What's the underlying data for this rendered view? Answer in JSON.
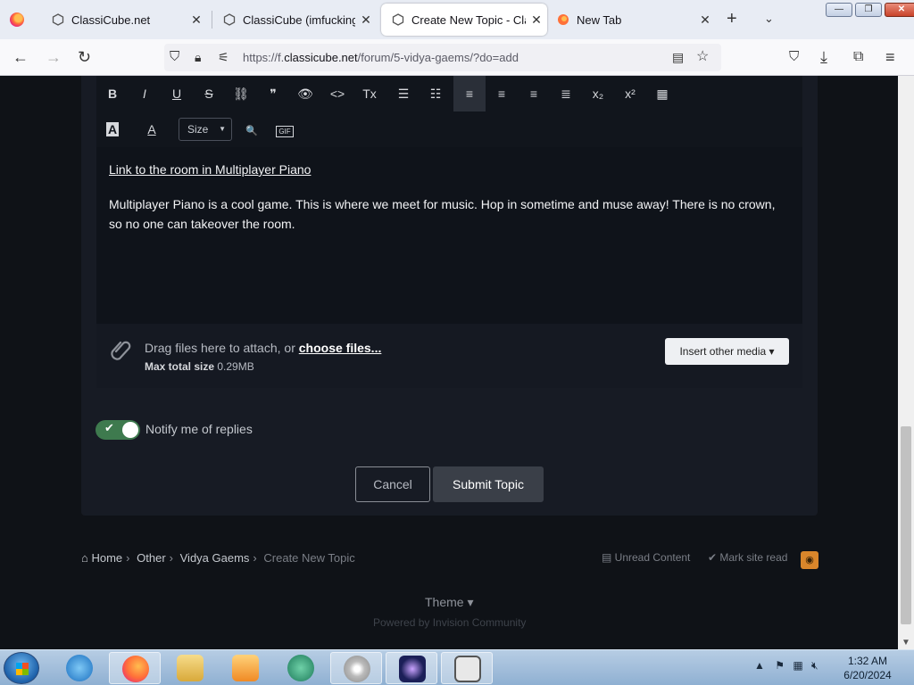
{
  "browser": {
    "tabs": [
      {
        "title": "ClassiCube.net",
        "close": "✕",
        "icon": "classicube-icon"
      },
      {
        "title": "ClassiCube (imfuckingo",
        "close": "✕",
        "icon": "classicube-icon"
      },
      {
        "title": "Create New Topic - Class",
        "close": "✕",
        "icon": "classicube-icon",
        "active": true
      },
      {
        "title": "New Tab",
        "close": "✕",
        "icon": "firefox-icon"
      }
    ],
    "new_tab": "+",
    "list_tabs": "⌄",
    "window_buttons": {
      "minimize": "—",
      "maximize": "❐",
      "close": "✕"
    },
    "url_prefix": "https://f.",
    "url_domain": "classicube.net",
    "url_path": "/forum/5-vidya-gaems/?do=add"
  },
  "editor": {
    "toolbar_row1": [
      {
        "name": "bold-button",
        "glyph": "B"
      },
      {
        "name": "italic-button",
        "glyph": "I"
      },
      {
        "name": "underline-button",
        "glyph": "U"
      },
      {
        "name": "strikethrough-button",
        "glyph": "S"
      },
      {
        "name": "link-button",
        "glyph": "⛓"
      },
      {
        "name": "quote-button",
        "glyph": "❞"
      },
      {
        "name": "spoiler-button",
        "glyph": "👁"
      },
      {
        "name": "code-button",
        "glyph": "<>"
      },
      {
        "name": "remove-format-button",
        "glyph": "Tx"
      },
      {
        "name": "bullet-list-button",
        "glyph": "☰"
      },
      {
        "name": "numbered-list-button",
        "glyph": "☷"
      },
      {
        "name": "align-left-button",
        "glyph": "≡"
      },
      {
        "name": "align-center-button",
        "glyph": "≡"
      },
      {
        "name": "align-right-button",
        "glyph": "≡"
      },
      {
        "name": "justify-button",
        "glyph": "≣"
      },
      {
        "name": "subscript-button",
        "glyph": "x₂"
      },
      {
        "name": "superscript-button",
        "glyph": "x²"
      },
      {
        "name": "table-button",
        "glyph": "▦"
      }
    ],
    "toolbar_row2": {
      "bg_color_glyph": "A",
      "text_color_glyph": "A",
      "size_label": "Size",
      "preview_glyph": "🔍",
      "gif_glyph": "GIF"
    },
    "link_text": "Link to the room in Multiplayer Piano",
    "body_text": "Multiplayer Piano is a cool game. This is where we meet for music. Hop in sometime and muse away! There is no crown, so no one can takeover the room."
  },
  "attachments": {
    "drag_text": "Drag files here to attach, or ",
    "choose_files": "choose files...",
    "max_size_label": "Max total size",
    "max_size_value": "0.29MB",
    "insert_media": "Insert other media ▾"
  },
  "notify": {
    "label": "Notify me of replies",
    "checked": true
  },
  "actions": {
    "cancel": "Cancel",
    "submit": "Submit Topic"
  },
  "breadcrumb": {
    "home": "Home",
    "other": "Other",
    "forum": "Vidya Gaems",
    "current": "Create New Topic"
  },
  "footer": {
    "unread": "Unread Content",
    "mark_read": "Mark site read",
    "theme": "Theme ▾",
    "powered": "Powered by Invision Community"
  },
  "taskbar": {
    "time": "1:32 AM",
    "date": "6/20/2024"
  },
  "colors": {
    "accent_green": "#3e7a4e",
    "page_bg": "#0f1217",
    "rss": "#d9862b"
  }
}
